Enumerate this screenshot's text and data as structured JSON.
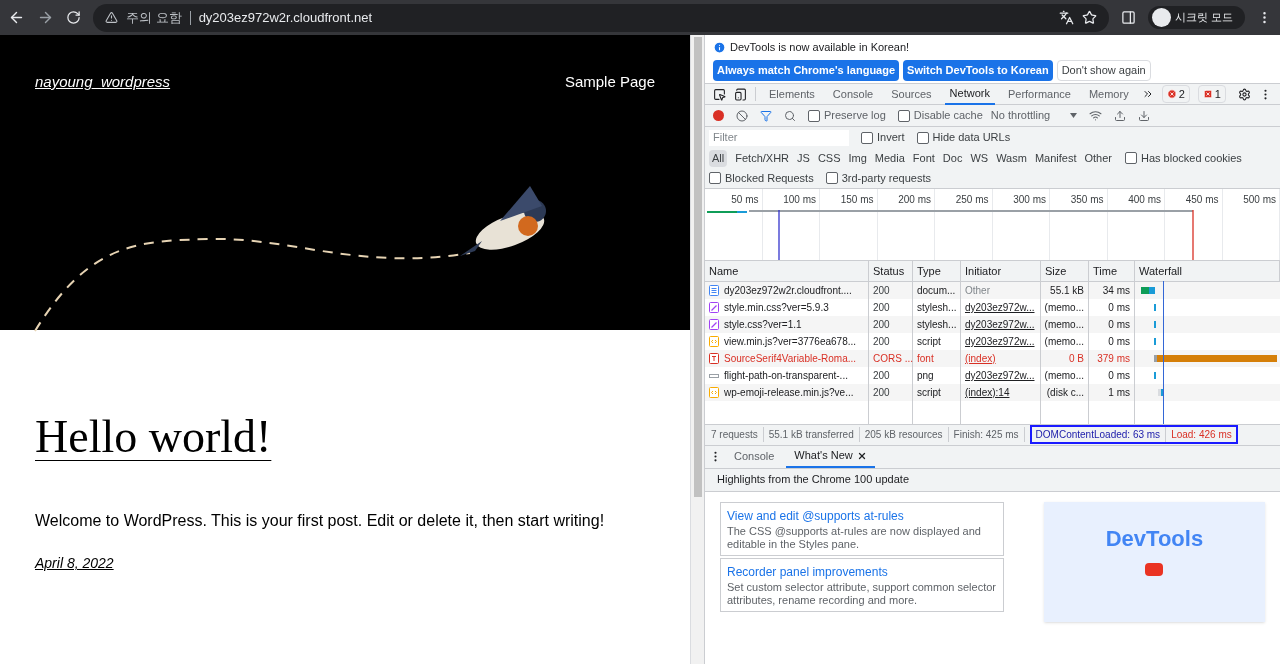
{
  "browser": {
    "security_label": "주의 요함",
    "url": "dy203ez972w2r.cloudfront.net",
    "profile_label": "시크릿 모드"
  },
  "page": {
    "site_title": "nayoung_wordpress",
    "nav_link": "Sample Page",
    "post_title": "Hello world!",
    "post_body": "Welcome to WordPress. This is your first post. Edit or delete it, then start writing!",
    "post_date": "April 8, 2022"
  },
  "devtools": {
    "infobar": {
      "message": "DevTools is now available in Korean!",
      "buttons": [
        {
          "label": "Always match Chrome's language",
          "kind": "primary"
        },
        {
          "label": "Switch DevTools to Korean",
          "kind": "primary"
        },
        {
          "label": "Don't show again",
          "kind": "secondary"
        }
      ]
    },
    "tabs": [
      {
        "label": "Elements",
        "selected": false
      },
      {
        "label": "Console",
        "selected": false
      },
      {
        "label": "Sources",
        "selected": false
      },
      {
        "label": "Network",
        "selected": true
      },
      {
        "label": "Performance",
        "selected": false
      },
      {
        "label": "Memory",
        "selected": false
      }
    ],
    "error_count": "2",
    "issue_count": "1",
    "preserve_log": {
      "label": "Preserve log",
      "checked": false
    },
    "disable_cache": {
      "label": "Disable cache",
      "checked": false
    },
    "throttling": "No throttling",
    "filter": {
      "placeholder": "Filter"
    },
    "invert": {
      "label": "Invert",
      "checked": false
    },
    "hide_data_urls": {
      "label": "Hide data URLs",
      "checked": false
    },
    "type_filters": [
      {
        "label": "All",
        "selected": true
      },
      {
        "label": "Fetch/XHR",
        "selected": false
      },
      {
        "label": "JS",
        "selected": false
      },
      {
        "label": "CSS",
        "selected": false
      },
      {
        "label": "Img",
        "selected": false
      },
      {
        "label": "Media",
        "selected": false
      },
      {
        "label": "Font",
        "selected": false
      },
      {
        "label": "Doc",
        "selected": false
      },
      {
        "label": "WS",
        "selected": false
      },
      {
        "label": "Wasm",
        "selected": false
      },
      {
        "label": "Manifest",
        "selected": false
      },
      {
        "label": "Other",
        "selected": false
      }
    ],
    "has_blocked_cookies": {
      "label": "Has blocked cookies",
      "checked": false
    },
    "blocked_requests": {
      "label": "Blocked Requests",
      "checked": false
    },
    "third_party": {
      "label": "3rd-party requests",
      "checked": false
    },
    "timeline_ticks": [
      "50 ms",
      "100 ms",
      "150 ms",
      "200 ms",
      "250 ms",
      "300 ms",
      "350 ms",
      "400 ms",
      "450 ms",
      "500 ms"
    ],
    "table": {
      "columns": [
        "Name",
        "Status",
        "Type",
        "Initiator",
        "Size",
        "Time",
        "Waterfall"
      ],
      "rows": [
        {
          "kind": "document",
          "name": "dy203ez972w2r.cloudfront....",
          "status": "200",
          "type": "docum...",
          "initiator": "Other",
          "initiator_link": false,
          "size": "55.1 kB",
          "time": "34 ms",
          "failed": false
        },
        {
          "kind": "stylesheet",
          "name": "style.min.css?ver=5.9.3",
          "status": "200",
          "type": "stylesh...",
          "initiator": "dy203ez972w...",
          "initiator_link": true,
          "size": "(memo...",
          "time": "0 ms",
          "failed": false
        },
        {
          "kind": "stylesheet",
          "name": "style.css?ver=1.1",
          "status": "200",
          "type": "stylesh...",
          "initiator": "dy203ez972w...",
          "initiator_link": true,
          "size": "(memo...",
          "time": "0 ms",
          "failed": false
        },
        {
          "kind": "script",
          "name": "view.min.js?ver=3776ea678...",
          "status": "200",
          "type": "script",
          "initiator": "dy203ez972w...",
          "initiator_link": true,
          "size": "(memo...",
          "time": "0 ms",
          "failed": false
        },
        {
          "kind": "font",
          "name": "SourceSerif4Variable-Roma...",
          "status": "CORS ...",
          "type": "font",
          "initiator": "(index)",
          "initiator_link": true,
          "size": "0 B",
          "time": "379 ms",
          "failed": true
        },
        {
          "kind": "image",
          "name": "flight-path-on-transparent-...",
          "status": "200",
          "type": "png",
          "initiator": "dy203ez972w...",
          "initiator_link": true,
          "size": "(memo...",
          "time": "0 ms",
          "failed": false
        },
        {
          "kind": "script",
          "name": "wp-emoji-release.min.js?ve...",
          "status": "200",
          "type": "script",
          "initiator": "(index):14",
          "initiator_link": true,
          "size": "(disk c...",
          "time": "1 ms",
          "failed": false
        }
      ]
    },
    "summary": [
      "7 requests",
      "55.1 kB transferred",
      "205 kB resources",
      "Finish: 425 ms"
    ],
    "dom_content_loaded": "DOMContentLoaded: 63 ms",
    "load": "Load: 426 ms",
    "drawer": {
      "tabs": [
        {
          "label": "Console",
          "selected": false,
          "closable": false
        },
        {
          "label": "What's New",
          "selected": true,
          "closable": true
        }
      ],
      "heading": "Highlights from the Chrome 100 update",
      "cards": [
        {
          "title": "View and edit @supports at-rules",
          "body": "The CSS @supports at-rules are now displayed and editable in the Styles pane."
        },
        {
          "title": "Recorder panel improvements",
          "body": "Set custom selector attribute, support common selector attributes, rename recording and more."
        }
      ],
      "promo_title": "DevTools"
    }
  }
}
